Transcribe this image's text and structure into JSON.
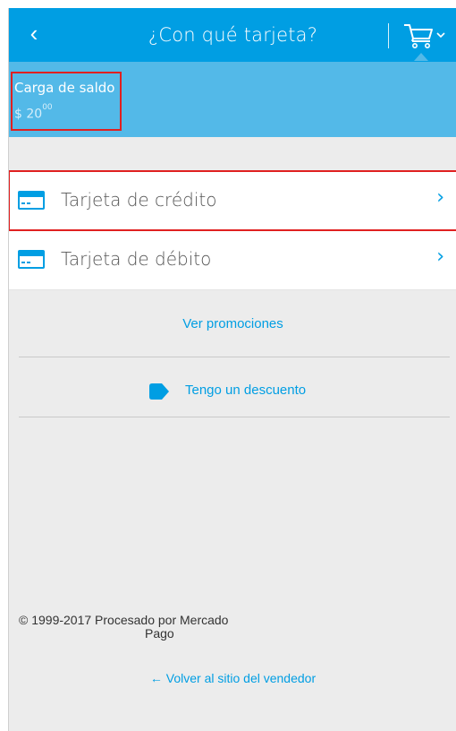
{
  "header": {
    "back_glyph": "‹",
    "title": "¿Con qué tarjeta?",
    "cart_icon": "cart-icon"
  },
  "summary": {
    "label": "Carga de saldo",
    "currency": "$",
    "amount_int": "20",
    "amount_dec": "00"
  },
  "payment_options": [
    {
      "label": "Tarjeta de crédito",
      "icon": "credit-card-icon",
      "selected": true
    },
    {
      "label": "Tarjeta de débito",
      "icon": "credit-card-icon",
      "selected": false
    }
  ],
  "links": {
    "promotions": "Ver promociones",
    "discount": "Tengo un descuento"
  },
  "footer": {
    "copyright_line1": "© 1999-2017 Procesado por Mercado",
    "copyright_line2": "Pago",
    "back_to_seller": "← Volver al sitio del vendedor"
  },
  "colors": {
    "primary": "#009ee3",
    "summary_bg": "#53b9e8",
    "page_bg": "#ececec",
    "highlight": "#e02020"
  }
}
